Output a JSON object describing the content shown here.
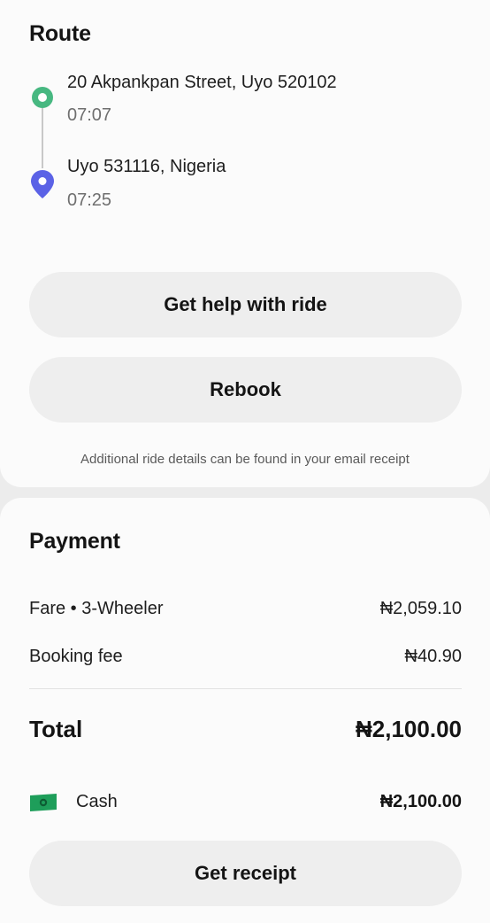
{
  "route": {
    "title": "Route",
    "stops": [
      {
        "address": "20 Akpankpan Street, Uyo 520102",
        "time": "07:07",
        "pin_color": "#47b881",
        "icon": "start-pin-icon"
      },
      {
        "address": "Uyo 531116, Nigeria",
        "time": "07:25",
        "pin_color": "#5b62e6",
        "icon": "destination-pin-icon"
      }
    ],
    "help_label": "Get help with ride",
    "rebook_label": "Rebook",
    "footnote": "Additional ride details can be found in your email receipt"
  },
  "payment": {
    "title": "Payment",
    "fare_label": "Fare • 3-Wheeler",
    "fare_value": "₦2,059.10",
    "fee_label": "Booking fee",
    "fee_value": "₦40.90",
    "total_label": "Total",
    "total_value": "₦2,100.00",
    "method_label": "Cash",
    "method_icon": "cash-icon",
    "method_color": "#1e9e5a",
    "method_value": "₦2,100.00",
    "receipt_label": "Get receipt"
  }
}
